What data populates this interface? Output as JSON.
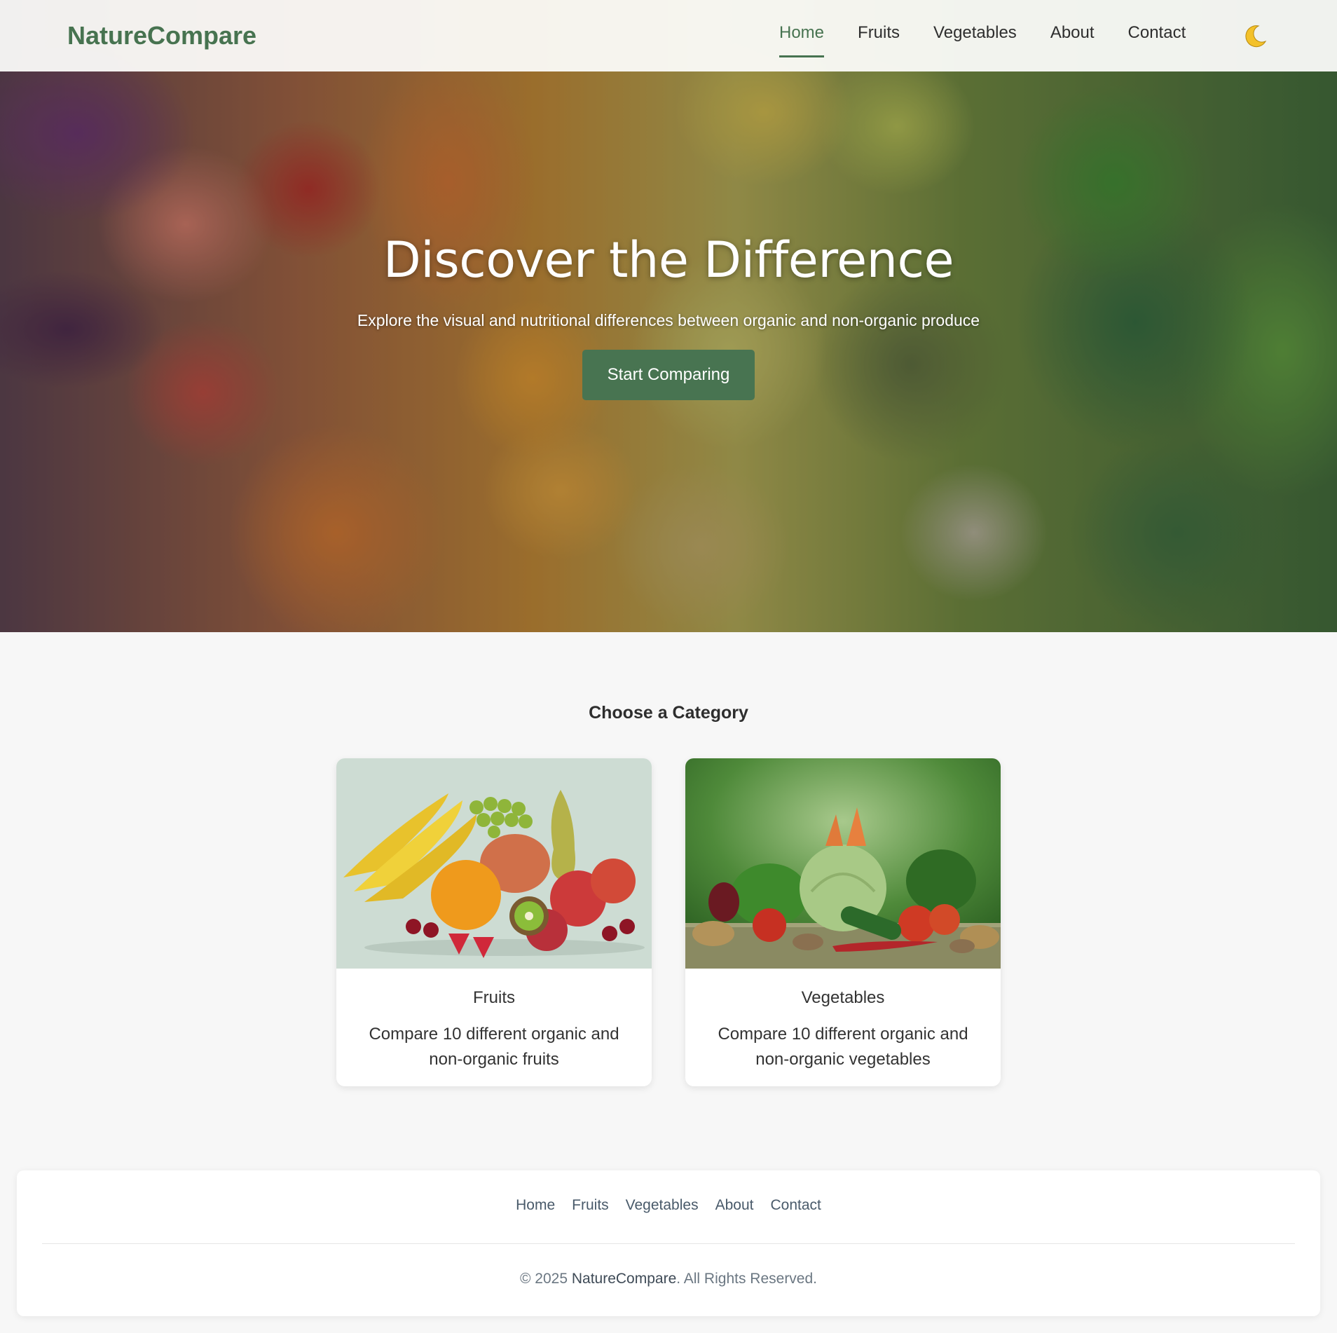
{
  "nav": {
    "brand": "NatureCompare",
    "links": [
      {
        "label": "Home",
        "active": true
      },
      {
        "label": "Fruits",
        "active": false
      },
      {
        "label": "Vegetables",
        "active": false
      },
      {
        "label": "About",
        "active": false
      },
      {
        "label": "Contact",
        "active": false
      }
    ],
    "theme_toggle_icon": "crescent-moon-icon"
  },
  "hero": {
    "title": "Discover the Difference",
    "subtitle": "Explore the visual and nutritional differences between organic and non-organic produce",
    "cta_label": "Start Comparing"
  },
  "categories": {
    "heading": "Choose a Category",
    "cards": [
      {
        "title": "Fruits",
        "description": "Compare 10 different organic and non-organic fruits"
      },
      {
        "title": "Vegetables",
        "description": "Compare 10 different organic and non-organic vegetables"
      }
    ]
  },
  "footer": {
    "links": [
      "Home",
      "Fruits",
      "Vegetables",
      "About",
      "Contact"
    ],
    "copyright_prefix": "© 2025 ",
    "copyright_brand": "NatureCompare",
    "copyright_suffix": ". All Rights Reserved."
  },
  "colors": {
    "brand_green": "#477350",
    "button_green": "#487451",
    "page_background": "#f7f7f7",
    "footer_link": "#495a6a",
    "moon_yellow": "#f3c12a"
  }
}
